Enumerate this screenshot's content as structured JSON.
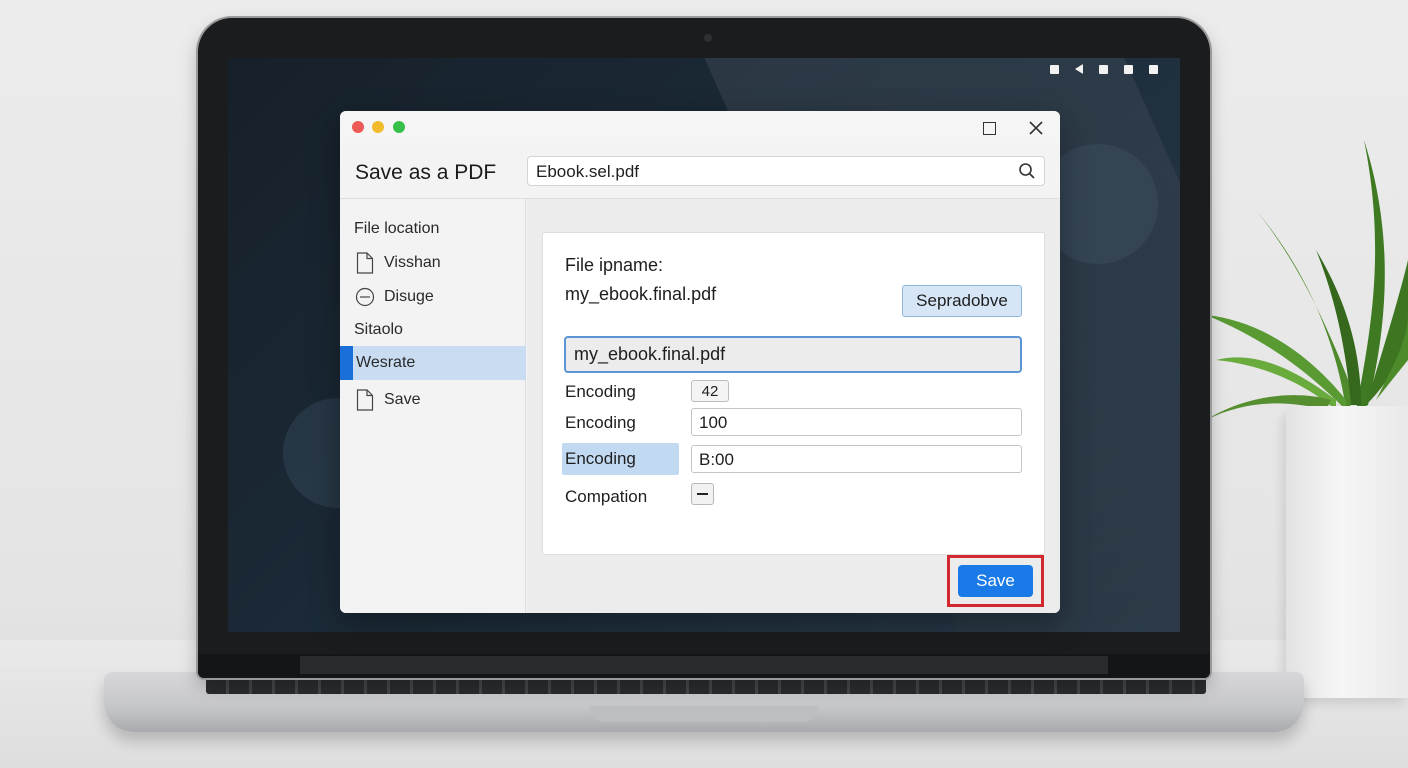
{
  "dialog": {
    "title": "Save as a PDF",
    "search_value": "Ebook.sel.pdf"
  },
  "sidebar": {
    "heading_location": "File location",
    "items": [
      {
        "label": "Visshan",
        "icon": "document-icon"
      },
      {
        "label": "Disuge",
        "icon": "plus-circle-icon"
      }
    ],
    "heading_section": "Sitaolo",
    "selected_item": "Wesrate",
    "save_item": {
      "label": "Save",
      "icon": "document-icon"
    }
  },
  "form": {
    "file_label": "File ipname:",
    "file_value": "my_ebook.final.pdf",
    "separate_button": "Sepradobve",
    "name_input_value": "my_ebook.final.pdf",
    "rows": [
      {
        "label": "Encoding",
        "value": "42"
      },
      {
        "label": "Encoding",
        "value": "100"
      },
      {
        "label": "Encoding",
        "value": "B:00"
      },
      {
        "label": "Compation"
      }
    ]
  },
  "footer": {
    "save_label": "Save"
  },
  "colors": {
    "accent": "#1a7ae8",
    "selection": "#c9dcf1",
    "highlight_frame": "#d3282e"
  }
}
